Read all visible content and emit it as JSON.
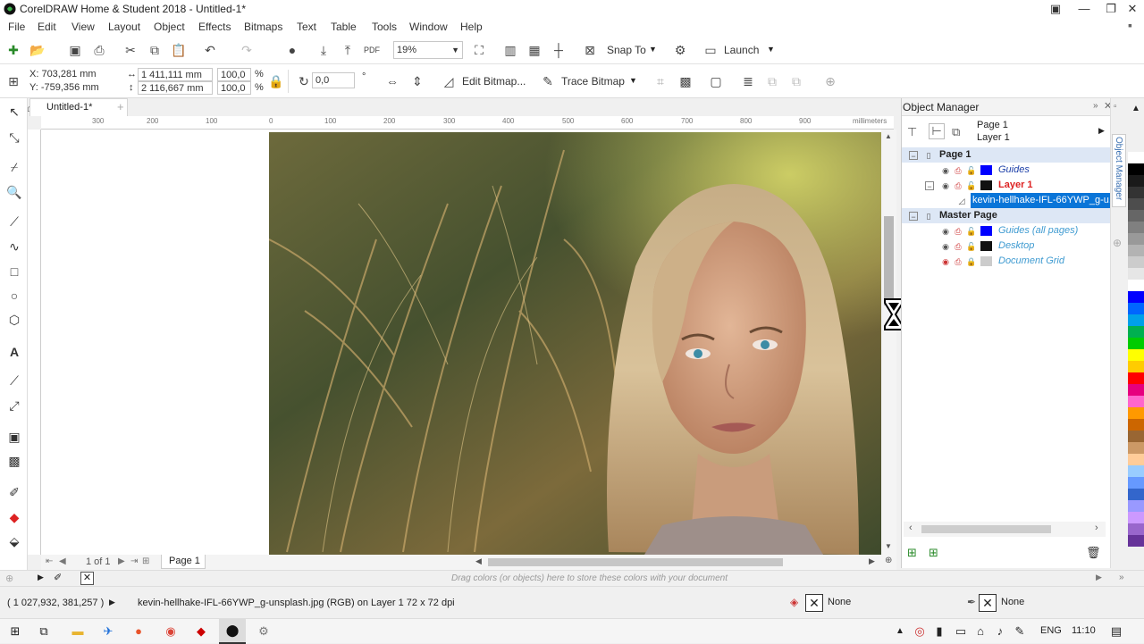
{
  "window": {
    "title": "CorelDRAW Home & Student 2018 - Untitled-1*"
  },
  "menu": [
    "File",
    "Edit",
    "View",
    "Layout",
    "Object",
    "Effects",
    "Bitmaps",
    "Text",
    "Table",
    "Tools",
    "Window",
    "Help"
  ],
  "toolbar": {
    "zoom": "19%",
    "snap_label": "Snap To",
    "launch_label": "Launch"
  },
  "property_bar": {
    "x": "X: 703,281 mm",
    "y": "Y: -759,356 mm",
    "width": "1 411,111 mm",
    "height": "2 116,667 mm",
    "scale_w": "100,0",
    "scale_h": "100,0",
    "percent": "%",
    "rotation": "0,0",
    "degree": "°",
    "edit_bitmap": "Edit Bitmap...",
    "trace_bitmap": "Trace Bitmap"
  },
  "doc_tab": {
    "label": "Untitled-1*"
  },
  "ruler": {
    "top_ticks": [
      "300",
      "200",
      "100",
      "0",
      "100",
      "200",
      "300",
      "400",
      "500",
      "600",
      "700",
      "800",
      "900"
    ],
    "unit": "millimeters"
  },
  "page_nav": {
    "position": "1 of 1",
    "page_tab": "Page 1"
  },
  "object_manager": {
    "title": "Object Manager",
    "header_page": "Page 1",
    "header_layer": "Layer 1",
    "tree": [
      {
        "label": "Page 1",
        "kind": "page"
      },
      {
        "label": "Guides",
        "kind": "layer",
        "color": "#0000ff"
      },
      {
        "label": "Layer 1",
        "kind": "active-layer",
        "color": "#111111"
      },
      {
        "label": "kevin-hellhake-IFL-66YWP_g-u...",
        "kind": "object"
      },
      {
        "label": "Master Page",
        "kind": "page"
      },
      {
        "label": "Guides (all pages)",
        "kind": "layer",
        "color": "#0000ff"
      },
      {
        "label": "Desktop",
        "kind": "layer",
        "color": "#111111"
      },
      {
        "label": "Document Grid",
        "kind": "layer",
        "color": "#cccccc"
      }
    ],
    "dock_tab": "Object Manager"
  },
  "colors_bar": {
    "hint": "Drag colors (or objects) here to store these colors with your document"
  },
  "status": {
    "coords": "( 1 027,932, 381,257 )",
    "info": "kevin-hellhake-IFL-66YWP_g-unsplash.jpg (RGB) on Layer 1 72 x 72 dpi",
    "fill_label": "None",
    "outline_label": "None"
  },
  "taskbar": {
    "lang": "ENG",
    "time": "11:10"
  },
  "palette": [
    "#ffffff",
    "#000000",
    "#1a1a1a",
    "#333333",
    "#4d4d4d",
    "#666666",
    "#808080",
    "#999999",
    "#b3b3b3",
    "#cccccc",
    "#e6e6e6",
    "#ffffff",
    "#0000ff",
    "#0066ff",
    "#00a0e9",
    "#00b050",
    "#00cc00",
    "#ffff00",
    "#ffcc00",
    "#ff0000",
    "#e6007e",
    "#ff66cc",
    "#ff9900",
    "#cc6600",
    "#996633",
    "#cc9966",
    "#ffcc99",
    "#99ccff",
    "#6699ff",
    "#3366cc",
    "#9999ff",
    "#cc99ff",
    "#9966cc",
    "#663399"
  ]
}
